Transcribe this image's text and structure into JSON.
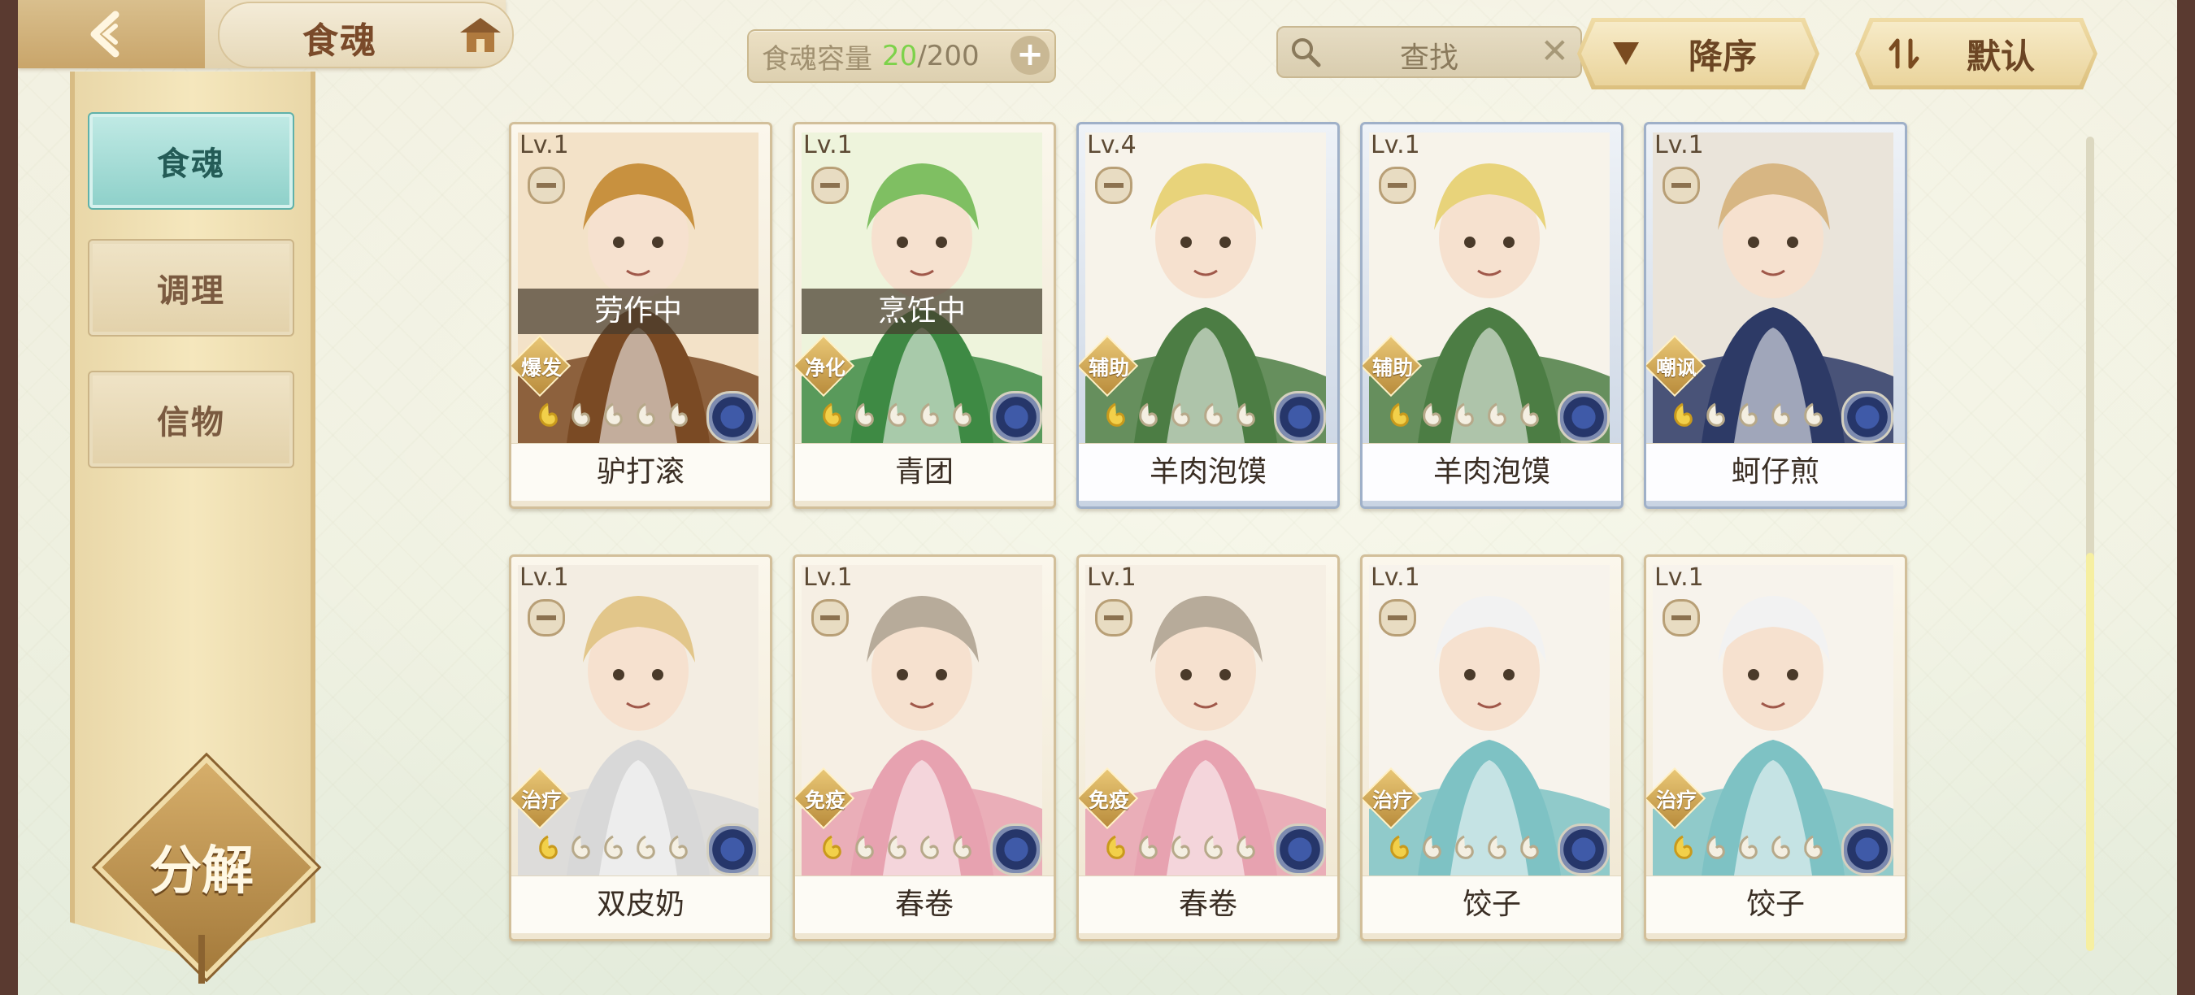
{
  "header": {
    "title": "食魂",
    "capacity_label": "食魂容量",
    "capacity_current": "20",
    "capacity_sep": "/",
    "capacity_max": "200",
    "capacity_add": "+",
    "search_placeholder": "查找",
    "search_clear": "✕",
    "sort_order": "降序",
    "sort_mode": "默认"
  },
  "sidebar": {
    "items": [
      {
        "label": "食魂",
        "active": true
      },
      {
        "label": "调理",
        "active": false
      },
      {
        "label": "信物",
        "active": false
      }
    ],
    "decompose_label": "分解"
  },
  "cards": [
    {
      "level": "Lv.1",
      "name": "驴打滚",
      "role": "爆发",
      "status": "劳作中",
      "stars": 1,
      "frame": "gold"
    },
    {
      "level": "Lv.1",
      "name": "青团",
      "role": "净化",
      "status": "烹饪中",
      "stars": 1,
      "frame": "gold"
    },
    {
      "level": "Lv.4",
      "name": "羊肉泡馍",
      "role": "辅助",
      "status": "",
      "stars": 1,
      "frame": "blue"
    },
    {
      "level": "Lv.1",
      "name": "羊肉泡馍",
      "role": "辅助",
      "status": "",
      "stars": 1,
      "frame": "blue"
    },
    {
      "level": "Lv.1",
      "name": "蚵仔煎",
      "role": "嘲讽",
      "status": "",
      "stars": 1,
      "frame": "blue"
    },
    {
      "level": "Lv.1",
      "name": "双皮奶",
      "role": "治疗",
      "status": "",
      "stars": 1,
      "frame": "gold"
    },
    {
      "level": "Lv.1",
      "name": "春卷",
      "role": "免疫",
      "status": "",
      "stars": 1,
      "frame": "gold"
    },
    {
      "level": "Lv.1",
      "name": "春卷",
      "role": "免疫",
      "status": "",
      "stars": 1,
      "frame": "gold"
    },
    {
      "level": "Lv.1",
      "name": "饺子",
      "role": "治疗",
      "status": "",
      "stars": 1,
      "frame": "gold"
    },
    {
      "level": "Lv.1",
      "name": "饺子",
      "role": "治疗",
      "status": "",
      "stars": 1,
      "frame": "gold"
    }
  ],
  "colors": {
    "accent_teal": "#8fd1ca",
    "capacity_green": "#7dd24a",
    "gold": "#dcc07e"
  },
  "icons": {
    "back": "back-arrow-icon",
    "home": "home-icon",
    "search": "search-icon",
    "sort": "sort-descending-icon",
    "filter": "filter-icon"
  }
}
